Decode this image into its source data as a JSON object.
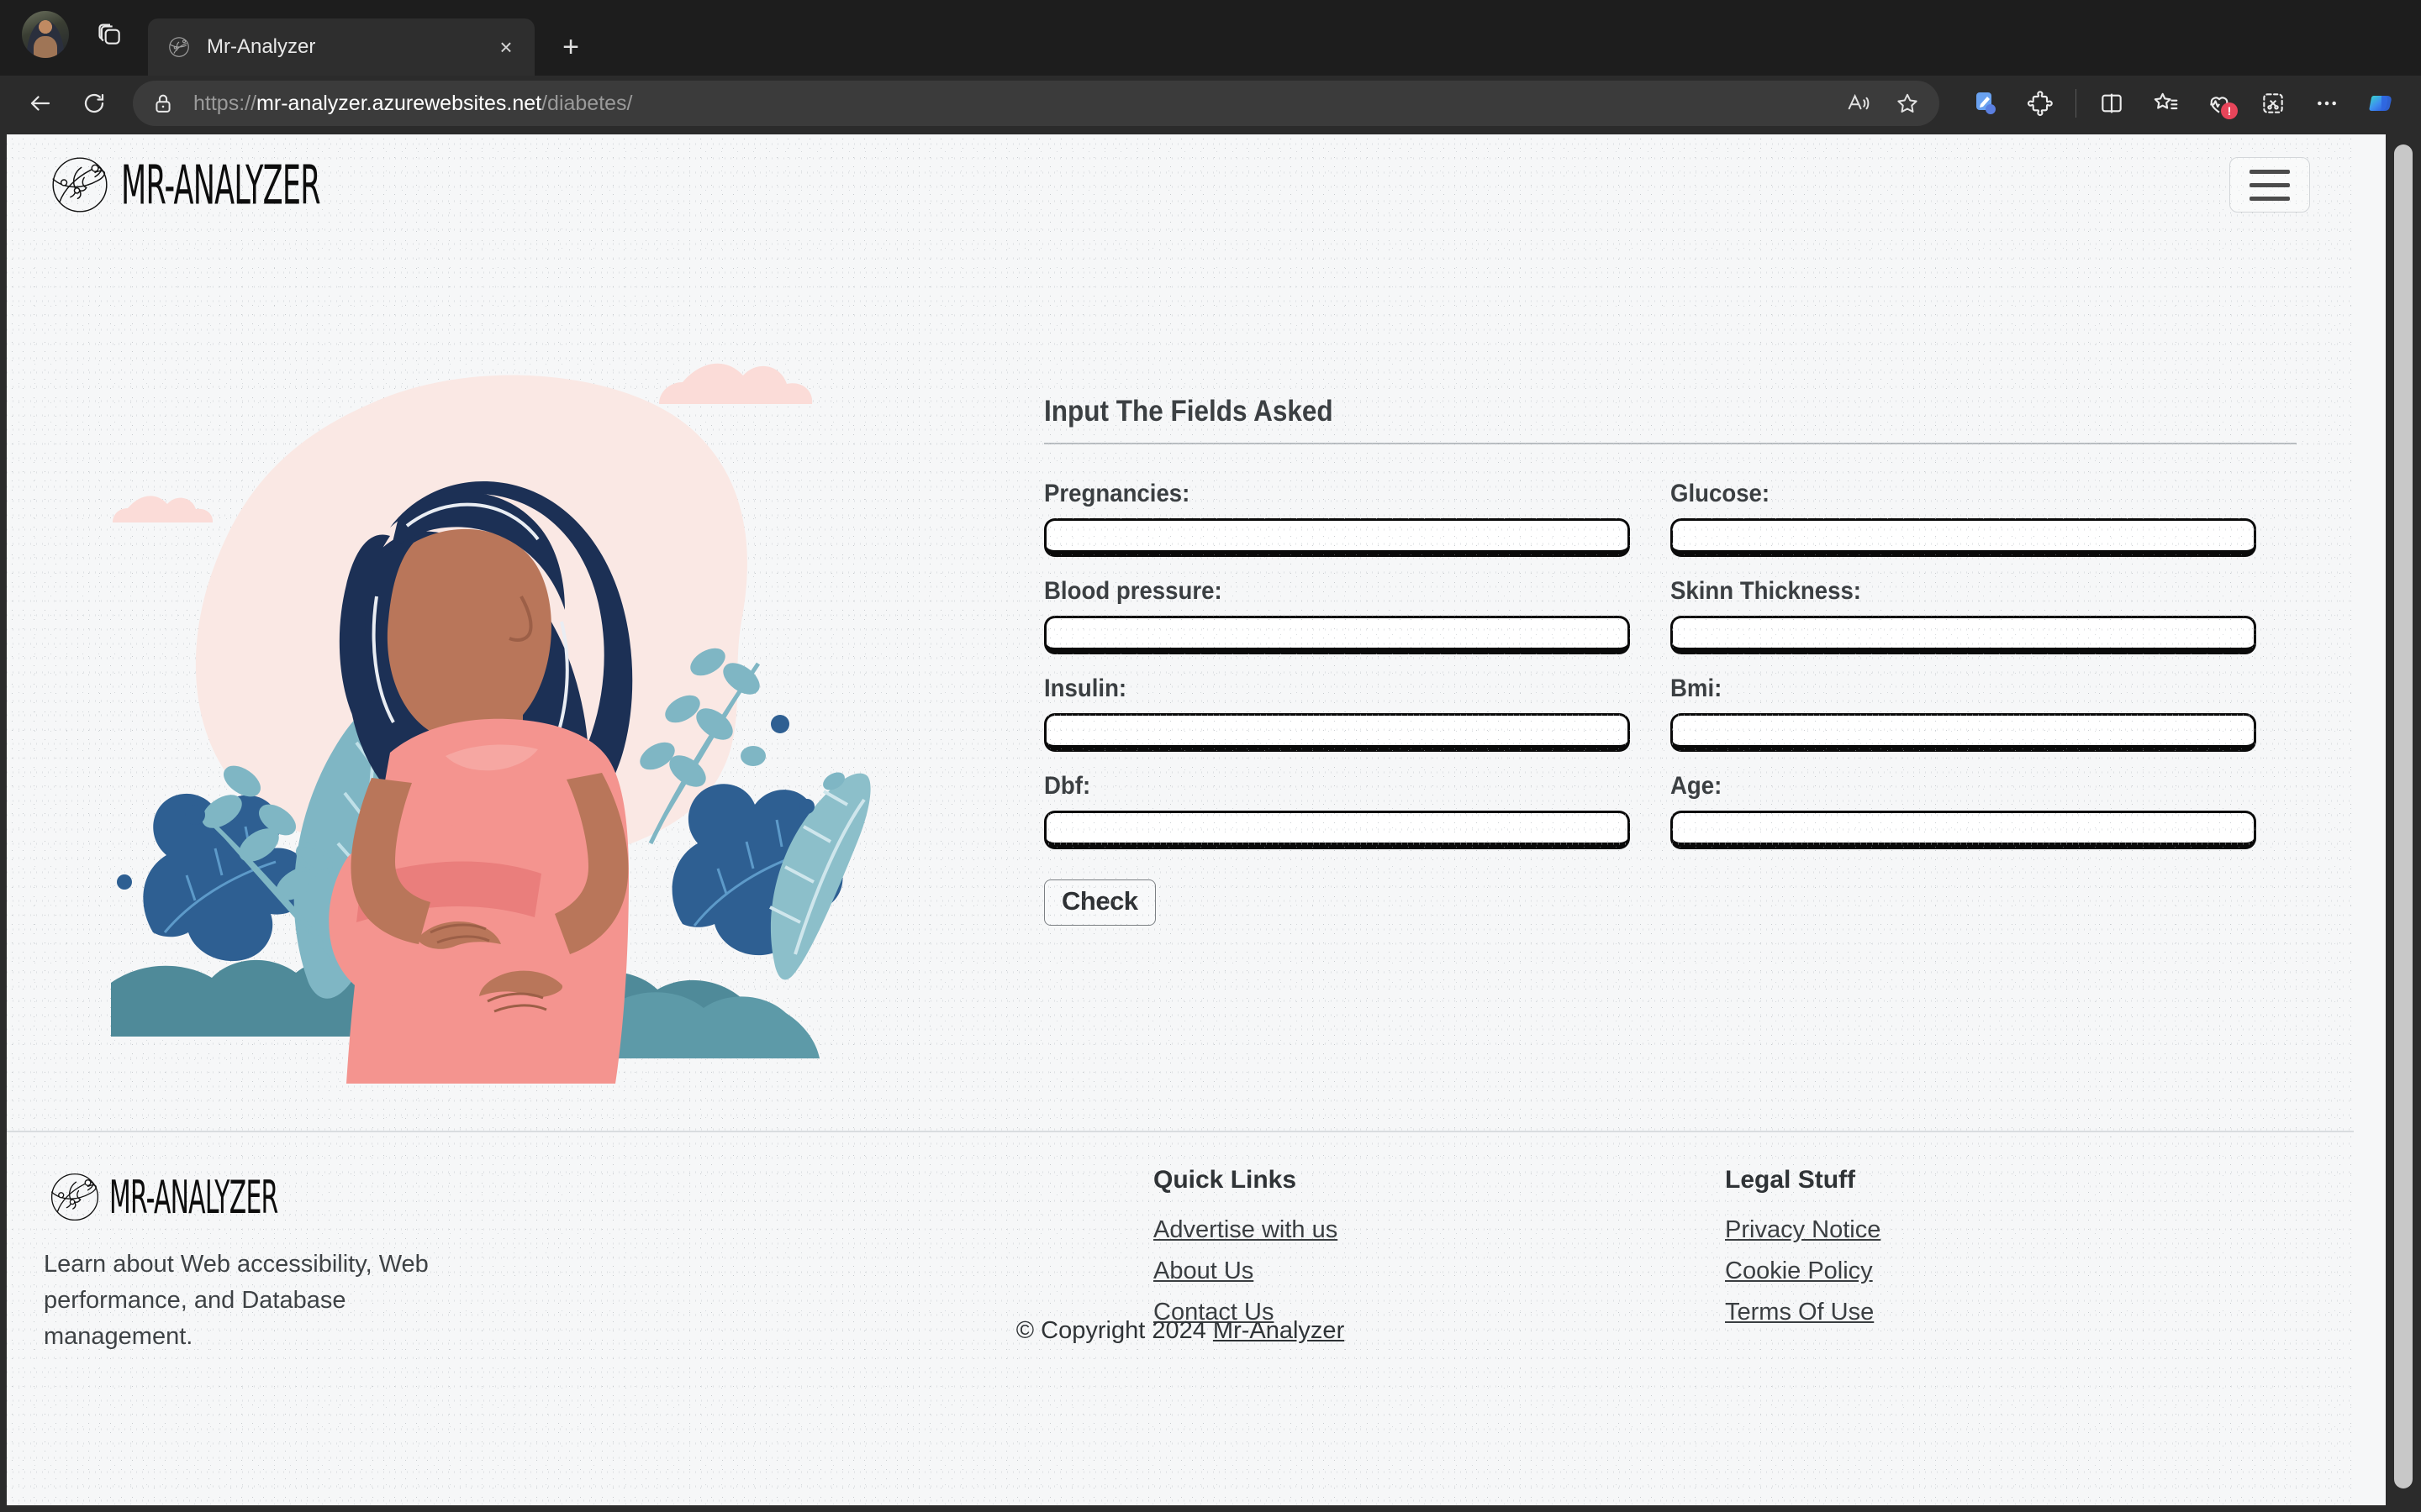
{
  "browser": {
    "tab": {
      "title": "Mr-Analyzer",
      "favicon": "globe-head-icon",
      "close_label": "×"
    },
    "new_tab_label": "+",
    "tab_search_icon": "tab-stack-icon",
    "avatar_name": "profile-avatar",
    "nav": {
      "back_icon": "back-arrow-icon",
      "reload_icon": "reload-icon"
    },
    "omnibox": {
      "lock_icon": "lock-icon",
      "url_scheme": "https://",
      "url_host": "mr-analyzer.azurewebsites.net",
      "url_path": "/diabetes/",
      "read_aloud_icon": "read-aloud-icon",
      "favorite_icon": "star-icon"
    },
    "toolbar": [
      {
        "name": "copilot-pages-icon",
        "badge": ""
      },
      {
        "name": "extensions-puzzle-icon",
        "badge": ""
      },
      {
        "name": "split-screen-icon",
        "badge": ""
      },
      {
        "name": "collections-icon",
        "badge": ""
      },
      {
        "name": "browser-essentials-icon",
        "badge": "!"
      },
      {
        "name": "screenshot-capture-icon",
        "badge": ""
      },
      {
        "name": "settings-more-icon",
        "badge": ""
      },
      {
        "name": "copilot-icon",
        "badge": ""
      }
    ]
  },
  "site": {
    "brand": "MR-ANALYZER",
    "menu_toggle": "navbar-toggle"
  },
  "form": {
    "heading": "Input The Fields Asked",
    "fields": [
      {
        "label": "Pregnancies:",
        "value": "",
        "placeholder": "",
        "name": "pregnancies"
      },
      {
        "label": "Glucose:",
        "value": "",
        "placeholder": "",
        "name": "glucose"
      },
      {
        "label": "Blood pressure:",
        "value": "",
        "placeholder": "",
        "name": "blood-pressure"
      },
      {
        "label": "Skinn Thickness:",
        "value": "",
        "placeholder": "",
        "name": "skin-thickness"
      },
      {
        "label": "Insulin:",
        "value": "",
        "placeholder": "",
        "name": "insulin"
      },
      {
        "label": "Bmi:",
        "value": "",
        "placeholder": "",
        "name": "bmi"
      },
      {
        "label": "Dbf:",
        "value": "",
        "placeholder": "",
        "name": "dbf"
      },
      {
        "label": "Age:",
        "value": "",
        "placeholder": "",
        "name": "age"
      }
    ],
    "submit_label": "Check"
  },
  "footer": {
    "brand": "MR-ANALYZER",
    "description": "Learn about Web accessibility, Web performance, and Database management.",
    "quick_links": {
      "title": "Quick Links",
      "items": [
        "Advertise with us",
        "About Us",
        "Contact Us"
      ]
    },
    "legal": {
      "title": "Legal Stuff",
      "items": [
        "Privacy Notice",
        "Cookie Policy",
        "Terms Of Use"
      ]
    },
    "copyright_prefix": "© Copyright 2024 ",
    "copyright_link": "Mr-Analyzer"
  },
  "colors": {
    "page_bg": "#f6f7f8",
    "chrome_bg": "#2b2b2b",
    "tabstrip_bg": "#1d1d1d",
    "input_border": "#0a0a0a",
    "text": "#3b3f42",
    "illustration_pink": "#f9e6e3",
    "illustration_dress": "#f4948f",
    "illustration_hair": "#1c3055",
    "illustration_skin": "#b9765a"
  }
}
